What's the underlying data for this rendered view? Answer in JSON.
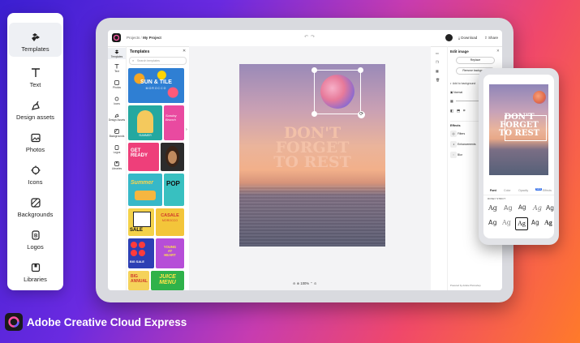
{
  "sidebar": {
    "items": [
      {
        "label": "Templates",
        "icon": "templates-icon",
        "active": true
      },
      {
        "label": "Text",
        "icon": "text-icon"
      },
      {
        "label": "Design assets",
        "icon": "design-assets-icon"
      },
      {
        "label": "Photos",
        "icon": "photos-icon"
      },
      {
        "label": "Icons",
        "icon": "icons-icon"
      },
      {
        "label": "Backgrounds",
        "icon": "backgrounds-icon"
      },
      {
        "label": "Logos",
        "icon": "logos-icon"
      },
      {
        "label": "Libraries",
        "icon": "libraries-icon"
      }
    ]
  },
  "app": {
    "breadcrumb_root": "Projects",
    "breadcrumb_sep": "/",
    "project_name": "My Project",
    "download": "Download",
    "share": "Share",
    "rail": [
      "Templates",
      "Text",
      "Photos",
      "Icons",
      "Design Assets",
      "Backgrounds",
      "Logos",
      "Libraries"
    ],
    "panel_title": "Templates",
    "search_placeholder": "Search templates",
    "zoom": "100%",
    "canvas_text_lines": [
      "DON'T",
      "FORGET",
      "TO REST"
    ]
  },
  "templates": [
    {
      "lines": [
        "SUN & TILE",
        "MOROCCO"
      ],
      "bg": "#2f7fd3",
      "fg": "#ffffff"
    },
    {
      "lines": [
        "SUMMER"
      ],
      "bg": "#24a8a0",
      "fg": "#ffffff"
    },
    {
      "lines": [
        "Sunday Brunch"
      ],
      "bg": "#e94aa0",
      "fg": "#ffffff"
    },
    {
      "lines": [
        "GET",
        "READY"
      ],
      "bg": "#ee3f7a",
      "fg": "#ffffff"
    },
    {
      "lines": [
        "Summer"
      ],
      "bg": "#36b8c8",
      "fg": "#ffd54a"
    },
    {
      "lines": [
        "POP"
      ],
      "bg": "#38c0c0",
      "fg": "#111111"
    },
    {
      "lines": [
        "SALE"
      ],
      "bg": "#f4d24a",
      "fg": "#111111"
    },
    {
      "lines": [
        "CASALE",
        "MOROCCO"
      ],
      "bg": "#f3c53a",
      "fg": "#d0392b"
    },
    {
      "lines": [
        "BIG SALE"
      ],
      "bg": "#2d3fb4",
      "fg": "#ffffff"
    },
    {
      "lines": [
        "YOUNG",
        "AT",
        "HEART"
      ],
      "bg": "#b64ed8",
      "fg": "#ffe34a"
    },
    {
      "lines": [
        "BIG",
        "ANNUAL"
      ],
      "bg": "#f5d25a",
      "fg": "#d0392b"
    },
    {
      "lines": [
        "JUICE",
        "MENU"
      ],
      "bg": "#2fb24a",
      "fg": "#ffe34a"
    }
  ],
  "right_panel": {
    "title": "Edit image",
    "replace": "Replace",
    "remove_bg": "Remove background",
    "add_bg": "Add to background",
    "blend": "Normal",
    "effects_title": "Effects",
    "effects": [
      "Filters",
      "Enhancements",
      "Blur"
    ],
    "footer": "Powered by Adobe Photoshop"
  },
  "phone": {
    "tabs": [
      "Font",
      "Color",
      "Opacity",
      "Effects"
    ],
    "effects_badge": "NEW",
    "font_label": "ROSEY STRICT",
    "font_sample": "Ag",
    "canvas_text_lines": [
      "DON'T",
      "FORGET",
      "TO REST"
    ]
  },
  "brand": {
    "name": "Adobe Creative Cloud Express",
    "logo": "creative-cloud-logo-icon"
  }
}
